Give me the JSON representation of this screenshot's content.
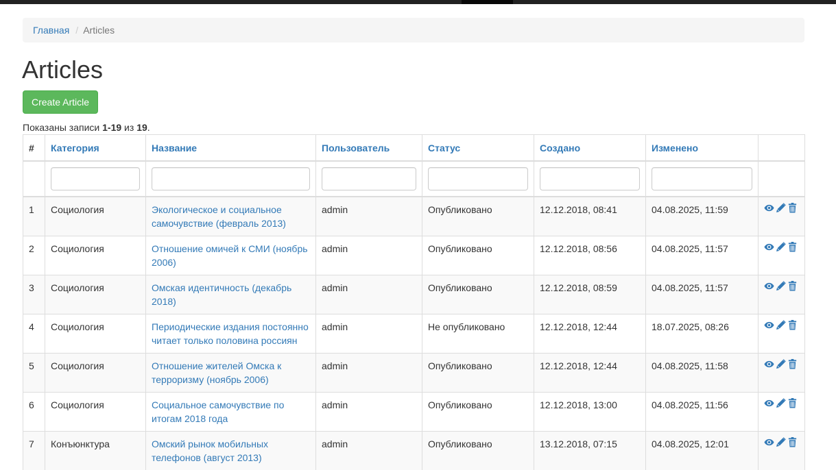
{
  "breadcrumb": {
    "home": "Главная",
    "separator": "/",
    "current": "Articles"
  },
  "page_title": "Articles",
  "create_button": "Create Article",
  "summary": {
    "prefix": "Показаны записи ",
    "range": "1-19",
    "middle": " из ",
    "total": "19",
    "suffix": "."
  },
  "columns": {
    "num": "#",
    "category": "Категория",
    "title": "Название",
    "user": "Пользователь",
    "status": "Статус",
    "created": "Создано",
    "updated": "Изменено"
  },
  "action_icons": [
    "eye-icon",
    "pencil-icon",
    "trash-icon"
  ],
  "colors": {
    "link": "#337ab7",
    "success": "#5cb85c"
  },
  "rows": [
    {
      "num": "1",
      "category": "Социология",
      "title": "Экологическое и социальное самочувствие (февраль 2013)",
      "user": "admin",
      "status": "Опубликовано",
      "created": "12.12.2018, 08:41",
      "updated": "04.08.2025, 11:59"
    },
    {
      "num": "2",
      "category": "Социология",
      "title": "Отношение омичей к СМИ (ноябрь 2006)",
      "user": "admin",
      "status": "Опубликовано",
      "created": "12.12.2018, 08:56",
      "updated": "04.08.2025, 11:57"
    },
    {
      "num": "3",
      "category": "Социология",
      "title": "Омская идентичность (декабрь 2018)",
      "user": "admin",
      "status": "Опубликовано",
      "created": "12.12.2018, 08:59",
      "updated": "04.08.2025, 11:57"
    },
    {
      "num": "4",
      "category": "Социология",
      "title": "Периодические издания постоянно читает только половина россиян",
      "user": "admin",
      "status": "Не опубликовано",
      "created": "12.12.2018, 12:44",
      "updated": "18.07.2025, 08:26"
    },
    {
      "num": "5",
      "category": "Социология",
      "title": "Отношение жителей Омска к терроризму (ноябрь 2006)",
      "user": "admin",
      "status": "Опубликовано",
      "created": "12.12.2018, 12:44",
      "updated": "04.08.2025, 11:58"
    },
    {
      "num": "6",
      "category": "Социология",
      "title": "Социальное самочувствие по итогам 2018 года",
      "user": "admin",
      "status": "Опубликовано",
      "created": "12.12.2018, 13:00",
      "updated": "04.08.2025, 11:56"
    },
    {
      "num": "7",
      "category": "Конъюнктура",
      "title": "Омский рынок мобильных телефонов (август 2013)",
      "user": "admin",
      "status": "Опубликовано",
      "created": "13.12.2018, 07:15",
      "updated": "04.08.2025, 12:01"
    }
  ]
}
